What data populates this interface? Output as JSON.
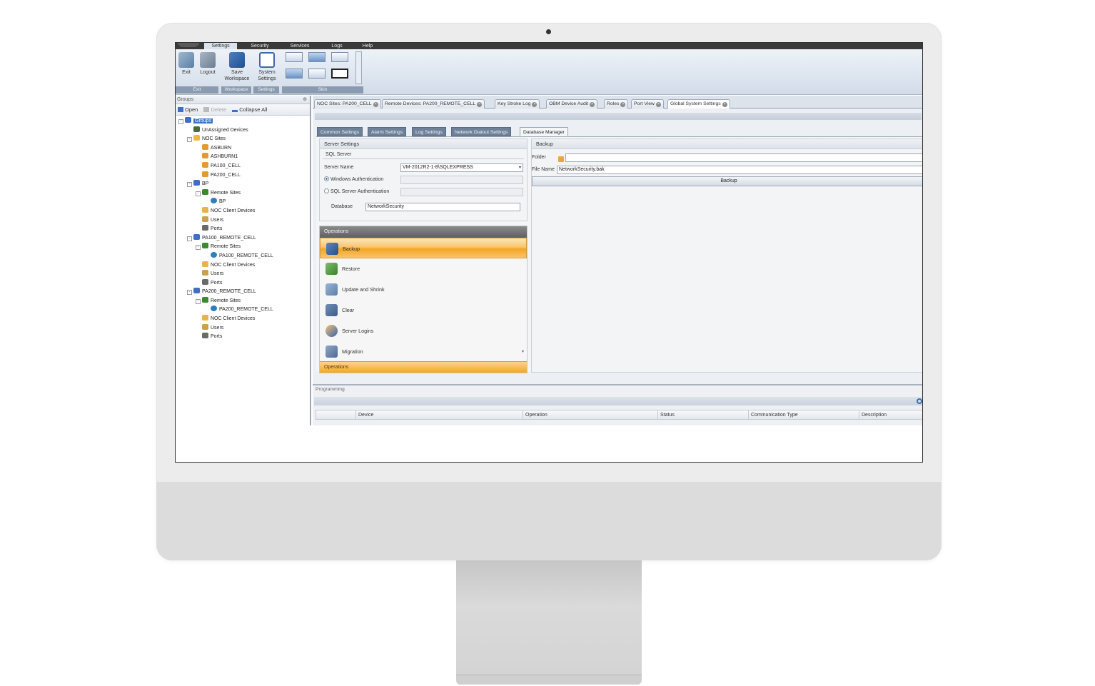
{
  "menu": {
    "tabs": [
      "Settings",
      "Security",
      "Services",
      "Logs",
      "Help"
    ],
    "active": "Settings"
  },
  "ribbon": {
    "exit": "Exit",
    "logout": "Logout",
    "save_workspace": "Save Workspace",
    "system_settings": "System Settings",
    "groups": [
      "Exit",
      "Workspace",
      "Settings",
      "Skin"
    ]
  },
  "left_panel": {
    "title": "Groups",
    "toolbar": {
      "open": "Open",
      "delete": "Delete",
      "collapse_all": "Collapse All"
    },
    "tree": [
      {
        "label": "Groups",
        "depth": 0,
        "icon": "group-icon",
        "selected": true,
        "expander": "-"
      },
      {
        "label": "UnAssigned Devices",
        "depth": 1,
        "icon": "unassigned-icon"
      },
      {
        "label": "NOC Sites",
        "depth": 1,
        "icon": "folder-icon",
        "expander": "-"
      },
      {
        "label": "ASBURN",
        "depth": 2,
        "icon": "site-icon"
      },
      {
        "label": "ASHBURN1",
        "depth": 2,
        "icon": "site-icon"
      },
      {
        "label": "PA100_CELL",
        "depth": 2,
        "icon": "site-icon"
      },
      {
        "label": "PA200_CELL",
        "depth": 2,
        "icon": "site-icon"
      },
      {
        "label": "BP",
        "depth": 1,
        "icon": "group-icon",
        "expander": "-"
      },
      {
        "label": "Remote Sites",
        "depth": 2,
        "icon": "flag-icon",
        "expander": "-"
      },
      {
        "label": "BP",
        "depth": 3,
        "icon": "globe-icon"
      },
      {
        "label": "NOC Client Devices",
        "depth": 2,
        "icon": "device-icon"
      },
      {
        "label": "Users",
        "depth": 2,
        "icon": "users-icon"
      },
      {
        "label": "Ports",
        "depth": 2,
        "icon": "ports-icon"
      },
      {
        "label": "PA100_REMOTE_CELL",
        "depth": 1,
        "icon": "group-icon",
        "expander": "-"
      },
      {
        "label": "Remote Sites",
        "depth": 2,
        "icon": "flag-icon",
        "expander": "-"
      },
      {
        "label": "PA100_REMOTE_CELL",
        "depth": 3,
        "icon": "globe-icon"
      },
      {
        "label": "NOC Client Devices",
        "depth": 2,
        "icon": "device-icon"
      },
      {
        "label": "Users",
        "depth": 2,
        "icon": "users-icon"
      },
      {
        "label": "Ports",
        "depth": 2,
        "icon": "ports-icon"
      },
      {
        "label": "PA200_REMOTE_CELL",
        "depth": 1,
        "icon": "group-icon",
        "expander": "-"
      },
      {
        "label": "Remote Sites",
        "depth": 2,
        "icon": "flag-icon",
        "expander": "-"
      },
      {
        "label": "PA200_REMOTE_CELL",
        "depth": 3,
        "icon": "globe-icon"
      },
      {
        "label": "NOC Client Devices",
        "depth": 2,
        "icon": "device-icon"
      },
      {
        "label": "Users",
        "depth": 2,
        "icon": "users-icon"
      },
      {
        "label": "Ports",
        "depth": 2,
        "icon": "ports-icon"
      }
    ]
  },
  "doc_tabs": [
    "NOC Sites: PA200_CELL",
    "Remote Devices: PA200_REMOTE_CELL",
    "Key Stroke Log",
    "OBM Device Audit",
    "Roles",
    "Port View",
    "Global System Settings"
  ],
  "sub_tabs": [
    "Common Settings",
    "Alarm Settings",
    "Log Settings",
    "Network Dialout Settings",
    "Database Manager"
  ],
  "server_settings": {
    "title": "Server Settings",
    "sql_server": "SQL Server",
    "server_name_label": "Server Name",
    "server_name_value": "VM-2012R2-1-8\\SQLEXPRESS",
    "windows_auth": "Windows Authentication",
    "sql_auth": "SQL Server Authentication",
    "database_label": "Database",
    "database_value": "NetworkSecurity"
  },
  "operations": {
    "header": "Operations",
    "items": [
      "Backup",
      "Restore",
      "Update and Shrink",
      "Clear",
      "Server Logins",
      "Migration"
    ],
    "footer": "Operations"
  },
  "backup": {
    "title": "Backup",
    "folder_label": "Folder",
    "folder_value": "",
    "file_name_label": "File Name",
    "file_name_value": "NetworkSecurity.bak",
    "button": "Backup"
  },
  "programming": {
    "title": "Programming",
    "columns": [
      "Device",
      "Operation",
      "Status",
      "Communication Type",
      "Description"
    ]
  }
}
